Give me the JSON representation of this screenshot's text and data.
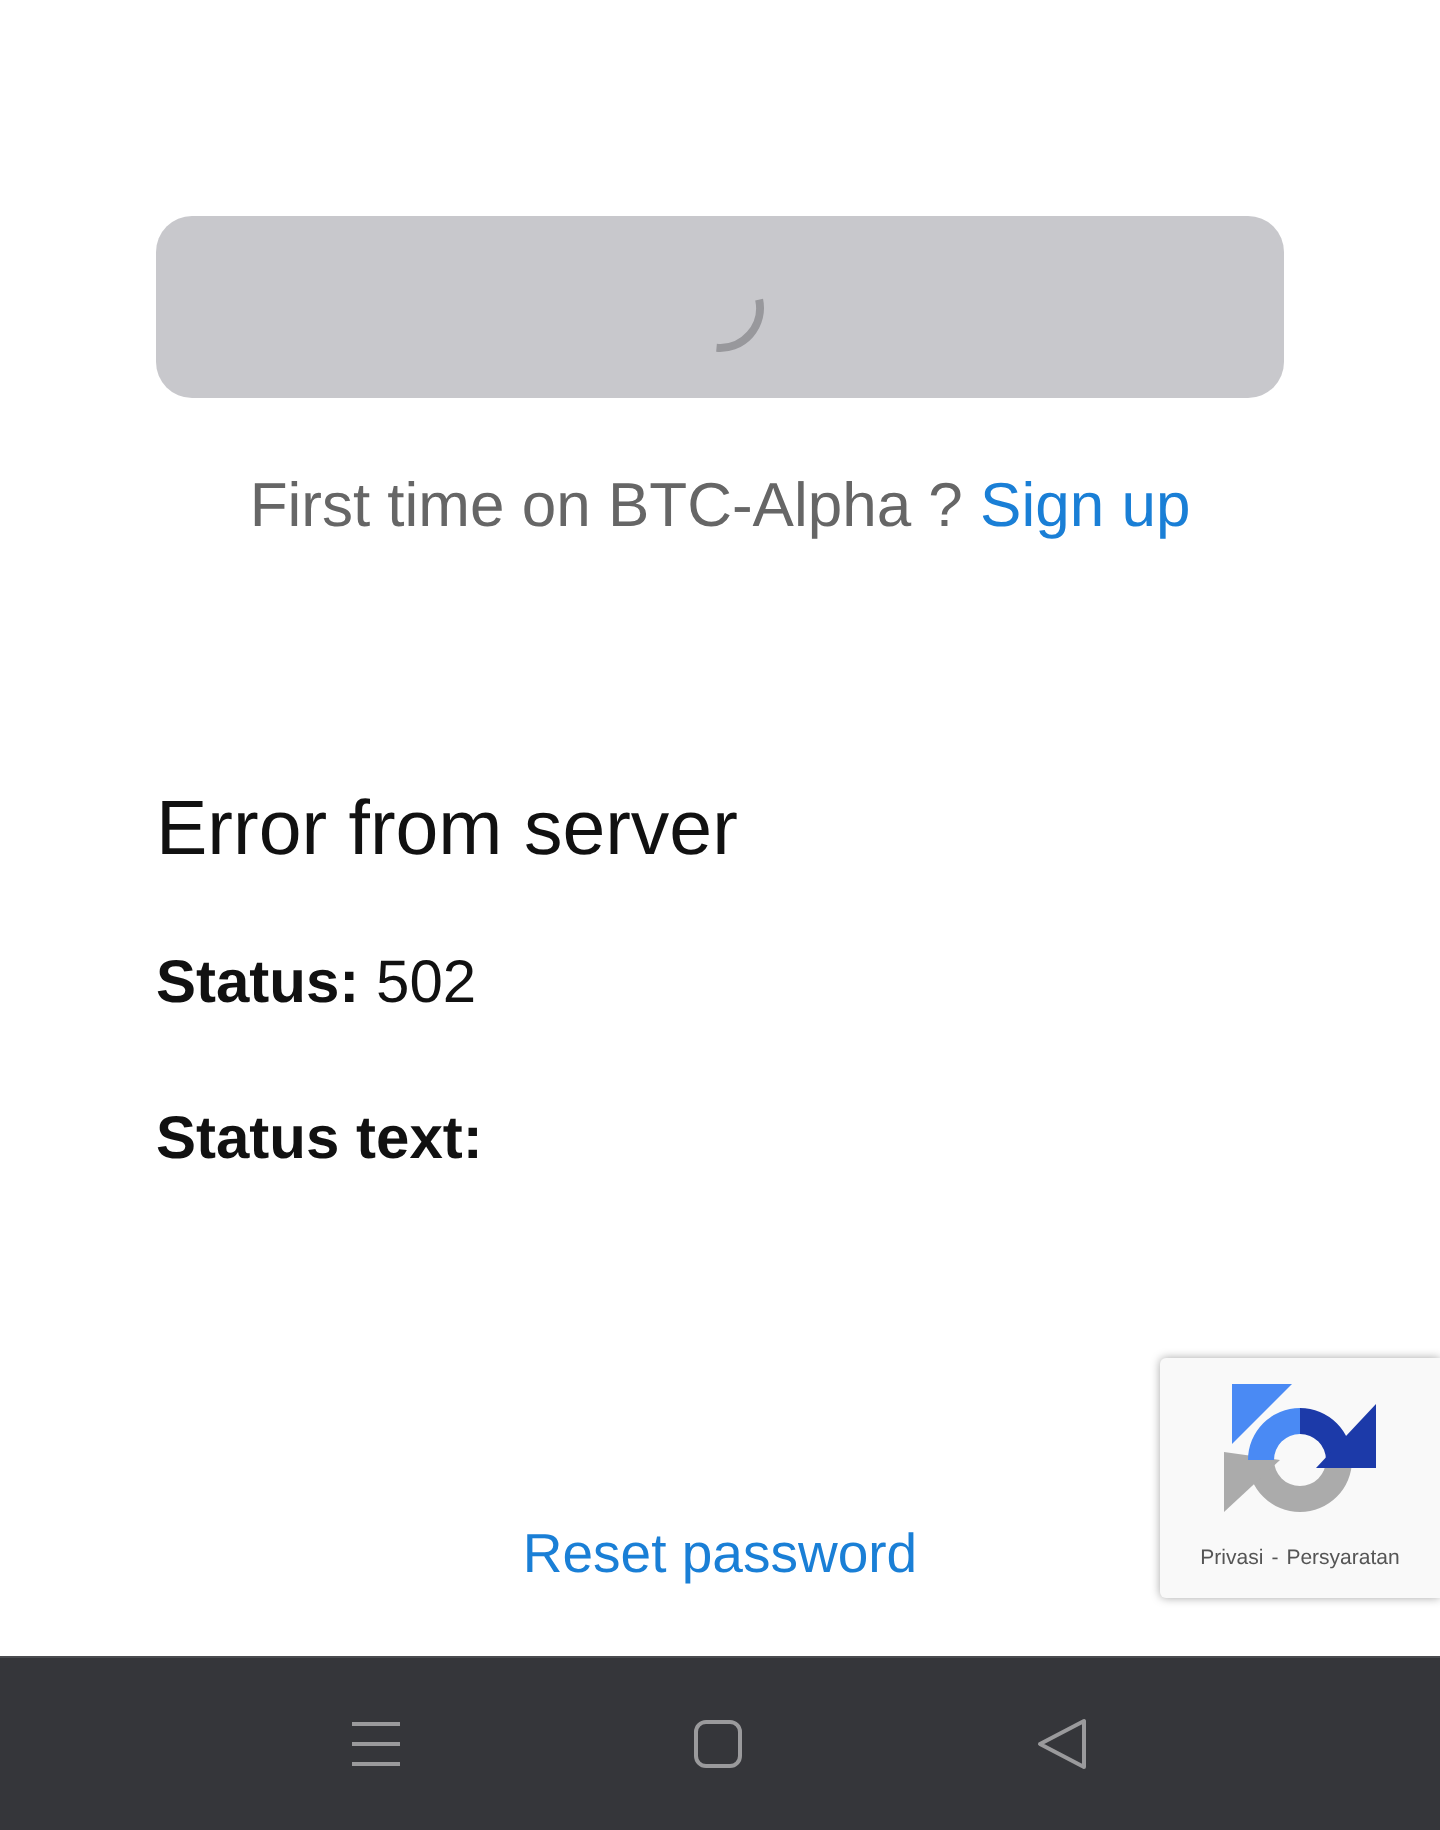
{
  "login_button": {
    "loading": true
  },
  "signup_prompt": {
    "text": "First time on BTC-Alpha ?",
    "link": "Sign up"
  },
  "error": {
    "title": "Error from server",
    "fields": [
      {
        "label": "Status:",
        "value": "502"
      },
      {
        "label": "Status text:"
      }
    ]
  },
  "reset_link": "Reset password",
  "captcha_badge": {
    "links": [
      "Privasi",
      "Persyaratan"
    ],
    "separator": "-"
  },
  "nav_bar": {
    "buttons": [
      {
        "kind": "menu"
      },
      {
        "kind": "home"
      },
      {
        "kind": "back"
      }
    ]
  }
}
